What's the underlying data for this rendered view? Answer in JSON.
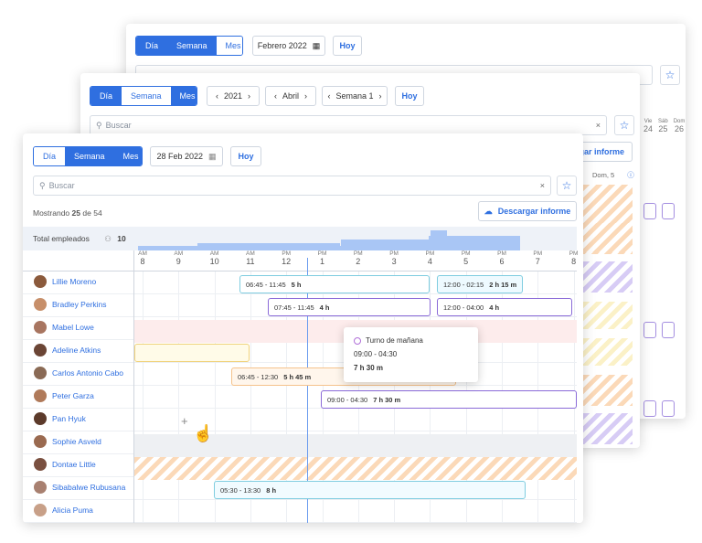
{
  "back": {
    "view_tabs": [
      "Día",
      "Semana",
      "Mes"
    ],
    "date": "Febrero 2022",
    "today": "Hoy",
    "days": [
      {
        "d": "Vie",
        "n": "24"
      },
      {
        "d": "Sáb",
        "n": "25"
      },
      {
        "d": "Dom",
        "n": "26"
      }
    ]
  },
  "middle": {
    "view_tabs": [
      "Día",
      "Semana",
      "Mes"
    ],
    "year": "2021",
    "month": "Abril",
    "week": "Semana 1",
    "today": "Hoy",
    "search_placeholder": "Buscar",
    "download": "Descargar informe",
    "day_header": "Dom, 5"
  },
  "front": {
    "view_tabs": [
      "Día",
      "Semana",
      "Mes"
    ],
    "date": "28 Feb 2022",
    "today": "Hoy",
    "search_placeholder": "Buscar",
    "showing": "Mostrando",
    "shown_count": "25",
    "of": "de",
    "total_count": "54",
    "download": "Descargar informe",
    "total_label": "Total empleados",
    "total_value": "10",
    "hours": [
      {
        "p": "AM",
        "h": "8"
      },
      {
        "p": "AM",
        "h": "9"
      },
      {
        "p": "AM",
        "h": "10"
      },
      {
        "p": "AM",
        "h": "11"
      },
      {
        "p": "PM",
        "h": "12"
      },
      {
        "p": "PM",
        "h": "1"
      },
      {
        "p": "PM",
        "h": "2"
      },
      {
        "p": "PM",
        "h": "3"
      },
      {
        "p": "PM",
        "h": "4"
      },
      {
        "p": "PM",
        "h": "5"
      },
      {
        "p": "PM",
        "h": "6"
      },
      {
        "p": "PM",
        "h": "7"
      },
      {
        "p": "PM",
        "h": "8"
      }
    ],
    "employees": [
      "Lillie Moreno",
      "Bradley Perkins",
      "Mabel Lowe",
      "Adeline Atkins",
      "Carlos Antonio Cabo",
      "Peter Garza",
      "Pan Hyuk",
      "Sophie Asveld",
      "Dontae Little",
      "Sibabalwe Rubusana",
      "Alicia Puma"
    ],
    "shifts": [
      {
        "time": "06:45 - 11:45",
        "dur": "5 h"
      },
      {
        "time": "12:00 - 02:15",
        "dur": "2 h 15 m"
      },
      {
        "time": "07:45 - 11:45",
        "dur": "4 h"
      },
      {
        "time": "12:00 - 04:00",
        "dur": "4 h"
      },
      {
        "time": "06:45 - 12:30",
        "dur": "5 h 45 m"
      },
      {
        "time": "09:00 - 04:30",
        "dur": "7 h 30 m"
      },
      {
        "time": "05:30 - 13:30",
        "dur": "8 h"
      }
    ],
    "tooltip": {
      "title": "Turno de mañana",
      "time": "09:00 - 04:30",
      "dur": "7 h 30 m"
    }
  },
  "colors": {
    "primary": "#2f6fe0",
    "orange": "#f5c38c",
    "purple": "#8a6ad8",
    "yellow": "#f0d27a",
    "teal": "#7fcde0"
  }
}
